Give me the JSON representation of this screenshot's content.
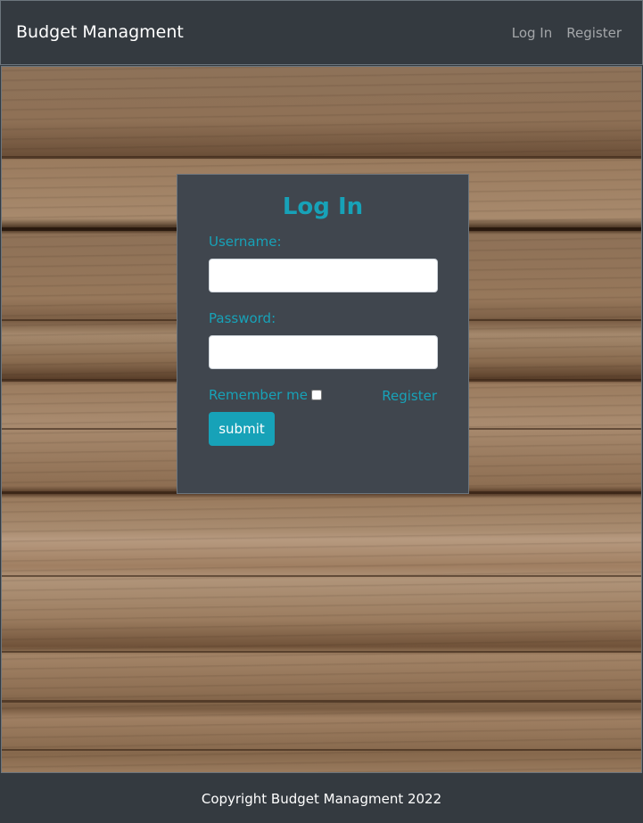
{
  "navbar": {
    "brand": "Budget Managment",
    "links": [
      "Log In",
      "Register"
    ]
  },
  "login_form": {
    "title": "Log In",
    "username_label": "Username:",
    "username_value": "",
    "password_label": "Password:",
    "password_value": "",
    "remember_label": "Remember me",
    "remember_checked": false,
    "register_link": "Register",
    "submit_label": "submit"
  },
  "footer": {
    "text": "Copyright Budget Managment 2022"
  },
  "colors": {
    "navbar_bg": "#343a40",
    "card_bg": "#40464e",
    "accent": "#17a2b8",
    "background_texture": "wood-planks"
  }
}
